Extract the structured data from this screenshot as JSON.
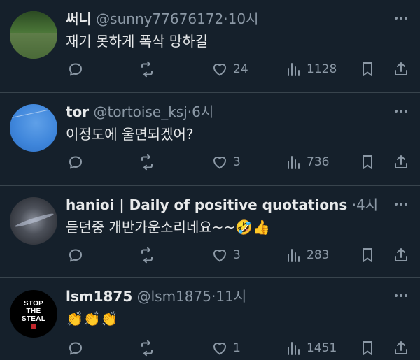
{
  "tweets": [
    {
      "name": "써니",
      "handle": "@sunny77676172",
      "time": "10시",
      "text": "재기 못하게 폭삭 망하길",
      "likes": "24",
      "views": "1128"
    },
    {
      "name": "tor",
      "handle": "@tortoise_ksj",
      "time": "6시",
      "text": "이정도에 울면되겠어?",
      "likes": "3",
      "views": "736"
    },
    {
      "name": "hanioi | Daily of positive quotations",
      "handle": "",
      "time": "4시",
      "text": "듣던중 개반가운소리네요~~🤣👍",
      "likes": "3",
      "views": "283"
    },
    {
      "name": "lsm1875",
      "handle": "@lsm1875",
      "time": "11시",
      "text": "👏👏👏",
      "likes": "1",
      "views": "1451",
      "avatar_text": [
        "STOP",
        "THE",
        "STEAL"
      ]
    }
  ],
  "colors": {
    "background": "#15202b",
    "text": "#e7e9ea",
    "muted": "#8b98a5",
    "divider": "#38444d"
  },
  "separator": "·"
}
